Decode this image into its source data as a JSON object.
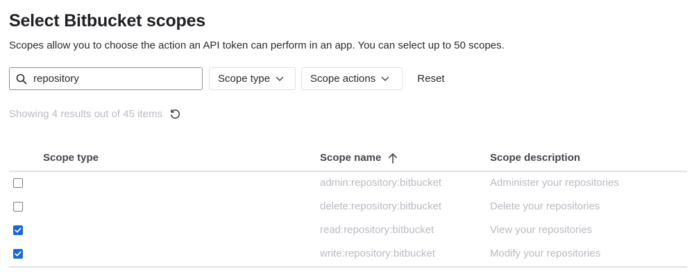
{
  "header": {
    "title": "Select Bitbucket scopes",
    "subtitle": "Scopes allow you to choose the action an API token can perform in an app. You can select up to 50 scopes."
  },
  "filters": {
    "search_value": "repository",
    "search_icon": "search-icon",
    "scope_type_label": "Scope type",
    "scope_actions_label": "Scope actions",
    "reset_label": "Reset"
  },
  "results": {
    "text": "Showing 4 results out of 45 items",
    "refresh_icon": "refresh-icon"
  },
  "table": {
    "headers": {
      "type": "Scope type",
      "name": "Scope name",
      "description": "Scope description"
    },
    "sort_icon": "arrow-up-icon",
    "rows": [
      {
        "checked": false,
        "type": "",
        "name": "admin:repository:bitbucket",
        "description": "Administer your repositories"
      },
      {
        "checked": false,
        "type": "",
        "name": "delete:repository:bitbucket",
        "description": "Delete your repositories"
      },
      {
        "checked": true,
        "type": "",
        "name": "read:repository:bitbucket",
        "description": "View your repositories"
      },
      {
        "checked": true,
        "type": "",
        "name": "write:repository:bitbucket",
        "description": "Modify your repositories"
      }
    ]
  },
  "colors": {
    "checkbox_checked": "#1868db",
    "muted_text": "#b8bbc2"
  }
}
